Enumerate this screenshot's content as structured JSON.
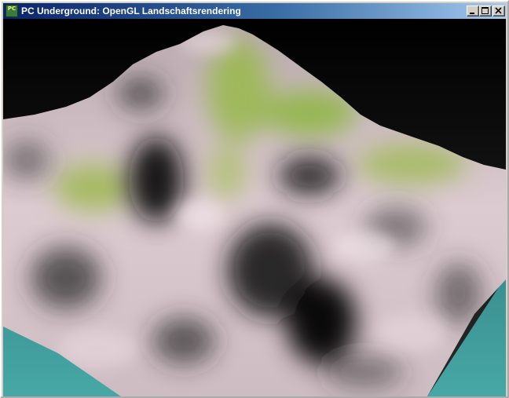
{
  "window": {
    "title": "PC Underground: OpenGL Landschaftsrendering",
    "icon_label": "PC",
    "icon_name": "pc-underground-app-icon",
    "buttons": {
      "minimize_icon": "minimize-icon",
      "maximize_icon": "maximize-icon",
      "close_icon": "close-icon"
    }
  },
  "viewport": {
    "content": "opengl-terrain-render",
    "colors": {
      "sky": "#000000",
      "ground_plane": "#3f9c9b",
      "rock": "#d9c6cc",
      "shadow": "#0c0c0c",
      "grass": "#98b84a"
    }
  }
}
